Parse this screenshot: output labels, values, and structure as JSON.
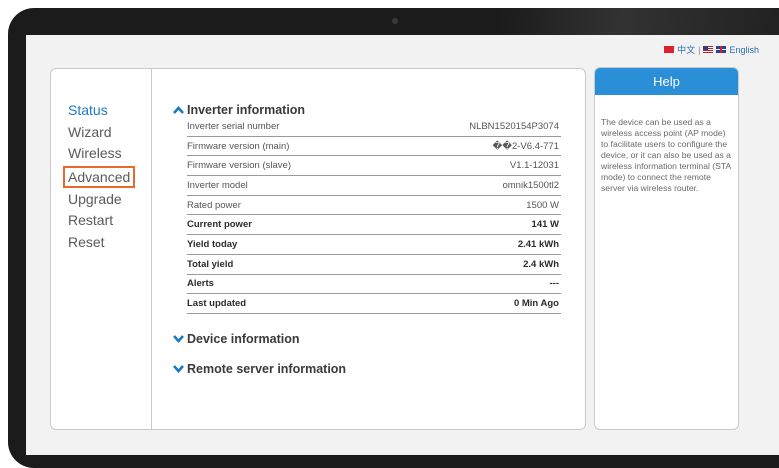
{
  "language": {
    "chinese_label": "中文",
    "separator": "|",
    "english_label": "English"
  },
  "menu": {
    "items": [
      {
        "label": "Status",
        "state": "active"
      },
      {
        "label": "Wizard",
        "state": "normal"
      },
      {
        "label": "Wireless",
        "state": "normal"
      },
      {
        "label": "Advanced",
        "state": "highlighted"
      },
      {
        "label": "Upgrade",
        "state": "normal"
      },
      {
        "label": "Restart",
        "state": "normal"
      },
      {
        "label": "Reset",
        "state": "normal"
      }
    ]
  },
  "inverter": {
    "title": "Inverter information",
    "rows": [
      {
        "label": "Inverter serial number",
        "value": "NLBN1520154P3074"
      },
      {
        "label": "Firmware version (main)",
        "value": "��2-V6.4-771"
      },
      {
        "label": "Firmware version (slave)",
        "value": "V1.1-12031"
      },
      {
        "label": "Inverter model",
        "value": "omnik1500tl2"
      },
      {
        "label": "Rated power",
        "value": "1500 W"
      },
      {
        "label": "Current power",
        "value": "141 W"
      },
      {
        "label": "Yield today",
        "value": "2.41 kWh"
      },
      {
        "label": "Total yield",
        "value": "2.4 kWh"
      },
      {
        "label": "Alerts",
        "value": "---"
      },
      {
        "label": "Last updated",
        "value": "0 Min Ago"
      }
    ]
  },
  "device_section": {
    "title": "Device information"
  },
  "remote_section": {
    "title": "Remote server information"
  },
  "help": {
    "title": "Help",
    "text": "The device can be used as a wireless access point (AP mode) to facilitate users to configure the device, or it can also be used as a wireless information terminal (STA mode) to connect the remote server via wireless router."
  },
  "colors": {
    "accent": "#2b8fd8",
    "menu_active": "#1a7ac4",
    "highlight_border": "#e8692a"
  }
}
